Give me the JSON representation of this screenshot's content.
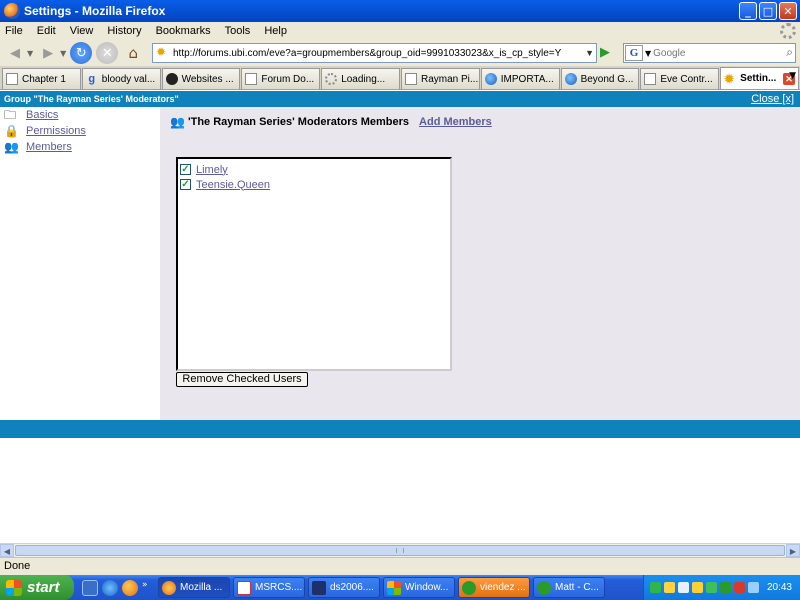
{
  "window": {
    "title": "Settings - Mozilla Firefox"
  },
  "menu": [
    "File",
    "Edit",
    "View",
    "History",
    "Bookmarks",
    "Tools",
    "Help"
  ],
  "address": {
    "url": "http://forums.ubi.com/eve?a=groupmembers&group_oid=9991033023&x_is_cp_style=Y"
  },
  "search": {
    "placeholder": "Google",
    "engine_letter": "G"
  },
  "tabs": [
    {
      "label": "Chapter 1",
      "icon": "document-icon"
    },
    {
      "label": "bloody val...",
      "icon": "google-icon"
    },
    {
      "label": "Websites ...",
      "icon": "webs-icon"
    },
    {
      "label": "Forum Do...",
      "icon": "document-icon"
    },
    {
      "label": "Loading...",
      "icon": "loading-icon"
    },
    {
      "label": "Rayman Pi...",
      "icon": "document-icon"
    },
    {
      "label": "IMPORTA...",
      "icon": "ubi-icon"
    },
    {
      "label": "Beyond G...",
      "icon": "ubi-icon"
    },
    {
      "label": "Eve Contr...",
      "icon": "document-icon"
    },
    {
      "label": "Settin...",
      "icon": "settings-icon",
      "active": true
    }
  ],
  "page": {
    "group_title": "Group \"The Rayman Series' Moderators\"",
    "close_label": "Close [x]",
    "nav": [
      {
        "label": "Basics",
        "icon": "basics-icon"
      },
      {
        "label": "Permissions",
        "icon": "permissions-icon"
      },
      {
        "label": "Members",
        "icon": "members-icon"
      }
    ],
    "heading": "'The Rayman Series' Moderators Members",
    "add_members": "Add Members",
    "members": [
      {
        "name": "Limely",
        "checked": true
      },
      {
        "name": "Teensie.Queen",
        "checked": true
      }
    ],
    "remove_button": "Remove Checked Users"
  },
  "status": {
    "text": "Done"
  },
  "taskbar": {
    "start": "start",
    "tasks": [
      {
        "label": "Mozilla ...",
        "active": true
      },
      {
        "label": "MSRCS...."
      },
      {
        "label": "ds2006...."
      },
      {
        "label": "Window..."
      },
      {
        "label": "viendez ...",
        "highlight": true
      },
      {
        "label": "Matt - C..."
      }
    ],
    "clock": "20:43"
  },
  "colors": {
    "header_blue": "#0f82bb",
    "link": "#5b5b9a",
    "panel_bg": "#e9e6ee"
  }
}
